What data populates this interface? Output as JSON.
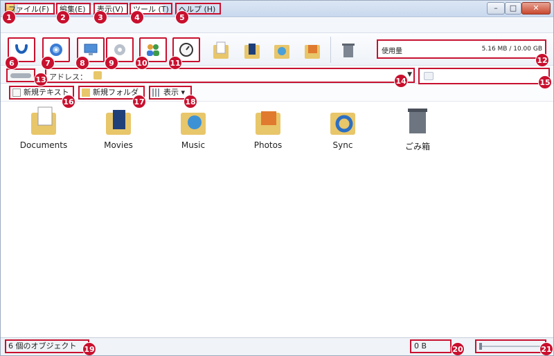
{
  "window": {
    "title": ""
  },
  "menu": [
    {
      "id": "file",
      "label": "ファイル(F)",
      "badge": "1"
    },
    {
      "id": "edit",
      "label": "編集(E)",
      "badge": "2"
    },
    {
      "id": "view",
      "label": "表示(V)",
      "badge": "3"
    },
    {
      "id": "tools",
      "label": "ツール (T)",
      "badge": "4"
    },
    {
      "id": "help",
      "label": "ヘルプ (H)",
      "badge": "5"
    }
  ],
  "toolbar": {
    "buttons": [
      {
        "icon": "sync-arrow-icon",
        "badge": "6"
      },
      {
        "icon": "disc-icon",
        "badge": "7"
      },
      {
        "icon": "monitor-icon",
        "badge": "8"
      },
      {
        "icon": "gear-icon",
        "badge": "9"
      },
      {
        "icon": "users-icon",
        "badge": "10"
      },
      {
        "icon": "gauge-icon",
        "badge": "11"
      }
    ],
    "quick_folders": [
      "documents-folder-icon",
      "movies-folder-icon",
      "music-folder-icon",
      "photos-folder-icon",
      "trash-icon"
    ],
    "usage": {
      "label": "使用量",
      "value": "5.16 MB / 10.00 GB",
      "badge": "12"
    }
  },
  "address": {
    "label": "アドレス：",
    "badge": "14",
    "back_badge": "13"
  },
  "search": {
    "placeholder": "",
    "badge": "15"
  },
  "actions": [
    {
      "label": "新規テキスト",
      "icon": "new-text-icon",
      "badge": "16"
    },
    {
      "label": "新規フォルダ",
      "icon": "new-folder-icon",
      "badge": "17"
    },
    {
      "label": "表示 ▾",
      "icon": "view-grid-icon",
      "badge": "18"
    }
  ],
  "files": [
    {
      "name": "Documents",
      "icon": "documents-folder-icon"
    },
    {
      "name": "Movies",
      "icon": "movies-folder-icon"
    },
    {
      "name": "Music",
      "icon": "music-folder-icon"
    },
    {
      "name": "Photos",
      "icon": "photos-folder-icon"
    },
    {
      "name": "Sync",
      "icon": "sync-folder-icon"
    },
    {
      "name": "ごみ箱",
      "icon": "trash-icon"
    }
  ],
  "status": {
    "object_count": "6 個のオブジェクト",
    "count_badge": "19",
    "size": "0 B",
    "size_badge": "20",
    "zoom_badge": "21"
  },
  "colors": {
    "callout": "#c8102e",
    "folder": "#e8c66a"
  }
}
